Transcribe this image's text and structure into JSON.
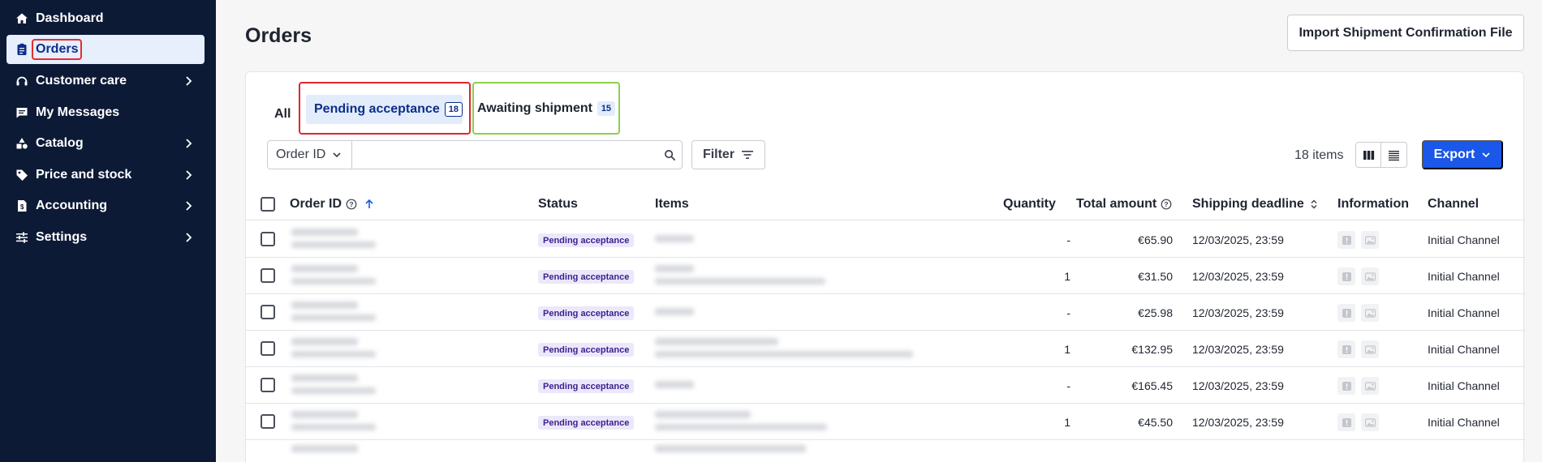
{
  "sidebar": {
    "items": [
      {
        "label": "Dashboard",
        "icon": "home-icon",
        "chevron": false,
        "active": false
      },
      {
        "label": "Orders",
        "icon": "clipboard-icon",
        "chevron": false,
        "active": true
      },
      {
        "label": "Customer care",
        "icon": "headset-icon",
        "chevron": true,
        "active": false
      },
      {
        "label": "My Messages",
        "icon": "message-icon",
        "chevron": false,
        "active": false
      },
      {
        "label": "Catalog",
        "icon": "shapes-icon",
        "chevron": true,
        "active": false
      },
      {
        "label": "Price and stock",
        "icon": "tag-icon",
        "chevron": true,
        "active": false
      },
      {
        "label": "Accounting",
        "icon": "invoice-icon",
        "chevron": true,
        "active": false
      },
      {
        "label": "Settings",
        "icon": "sliders-icon",
        "chevron": true,
        "active": false
      }
    ]
  },
  "header": {
    "title": "Orders",
    "import_label": "Import Shipment Confirmation File"
  },
  "tabs": {
    "all": "All",
    "pending": {
      "label": "Pending acceptance",
      "count": "18"
    },
    "awaiting": {
      "label": "Awaiting shipment",
      "count": "15"
    }
  },
  "toolbar": {
    "search_field": "Order ID",
    "search_value": "",
    "filter_label": "Filter",
    "items_count": "18 items",
    "export_label": "Export"
  },
  "table": {
    "columns": {
      "order_id": "Order ID",
      "status": "Status",
      "items": "Items",
      "quantity": "Quantity",
      "total": "Total amount",
      "deadline": "Shipping deadline",
      "information": "Information",
      "channel": "Channel"
    },
    "rows": [
      {
        "status": "Pending acceptance",
        "quantity": "-",
        "total": "€65.90",
        "deadline": "12/03/2025, 23:59",
        "channel": "Initial Channel"
      },
      {
        "status": "Pending acceptance",
        "quantity": "1",
        "total": "€31.50",
        "deadline": "12/03/2025, 23:59",
        "channel": "Initial Channel"
      },
      {
        "status": "Pending acceptance",
        "quantity": "-",
        "total": "€25.98",
        "deadline": "12/03/2025, 23:59",
        "channel": "Initial Channel"
      },
      {
        "status": "Pending acceptance",
        "quantity": "1",
        "total": "€132.95",
        "deadline": "12/03/2025, 23:59",
        "channel": "Initial Channel"
      },
      {
        "status": "Pending acceptance",
        "quantity": "-",
        "total": "€165.45",
        "deadline": "12/03/2025, 23:59",
        "channel": "Initial Channel"
      },
      {
        "status": "Pending acceptance",
        "quantity": "1",
        "total": "€45.50",
        "deadline": "12/03/2025, 23:59",
        "channel": "Initial Channel"
      }
    ]
  },
  "colors": {
    "sidebar_bg": "#0c1a36",
    "accent": "#1b57e8",
    "highlight_red": "#e0262e",
    "highlight_green": "#8cd04e",
    "status_badge_bg": "#ece8fb"
  }
}
